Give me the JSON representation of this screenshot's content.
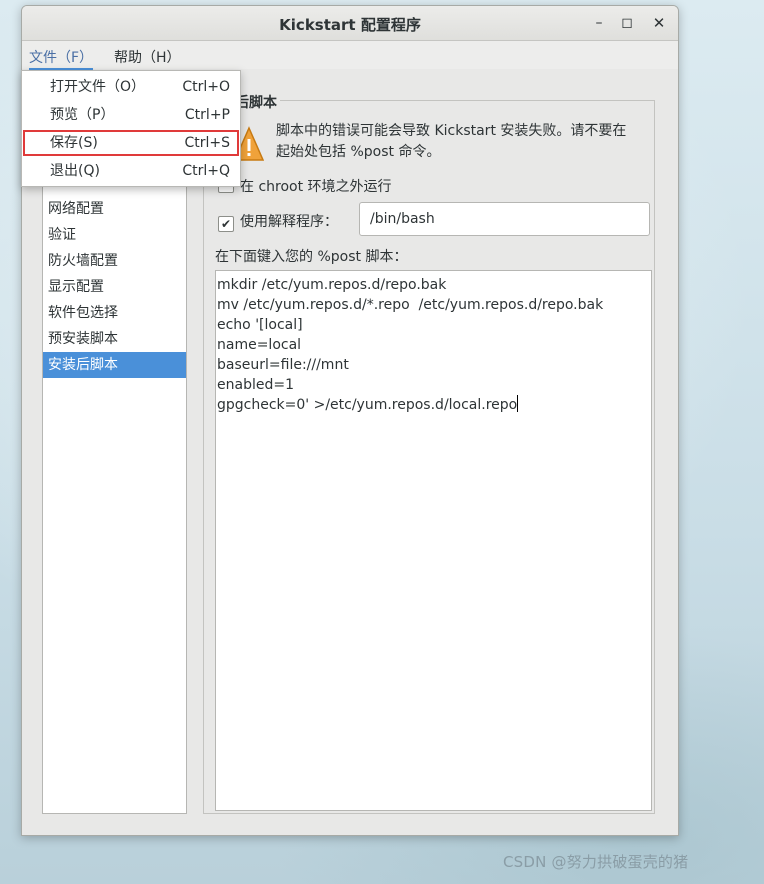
{
  "window": {
    "title": "Kickstart 配置程序",
    "controls": {
      "minimize": "–",
      "maximize": "◻",
      "close": "✕"
    }
  },
  "menubar": {
    "file": "文件（F）",
    "help": "帮助（H）"
  },
  "file_menu": {
    "items": [
      {
        "label": "打开文件（O）",
        "accel": "Ctrl+O"
      },
      {
        "label": "预览（P）",
        "accel": "Ctrl+P"
      },
      {
        "label": "保存(S)",
        "accel": "Ctrl+S"
      },
      {
        "label": "退出(Q)",
        "accel": "Ctrl+Q"
      }
    ],
    "highlighted_index": 2,
    "highlight_color": "#e03a3a"
  },
  "sidebar": {
    "items": [
      {
        "label": "网络配置",
        "selected": false
      },
      {
        "label": "验证",
        "selected": false
      },
      {
        "label": "防火墙配置",
        "selected": false
      },
      {
        "label": "显示配置",
        "selected": false
      },
      {
        "label": "软件包选择",
        "selected": false
      },
      {
        "label": "预安装脚本",
        "selected": false
      },
      {
        "label": "安装后脚本",
        "selected": true
      }
    ],
    "selected_color": "#4a90d9"
  },
  "panel": {
    "title": "后脚本",
    "warning_icon": "warning-triangle-icon",
    "warning_text": "脚本中的错误可能会导致 Kickstart 安装失败。请不要在起始处包括 %post 命令。",
    "chroot_label": "在 chroot 环境之外运行",
    "chroot_checked": false,
    "interpreter_label": "使用解释程序：",
    "interpreter_checked": true,
    "interpreter_value": "/bin/bash",
    "script_label": "在下面键入您的 %post 脚本：",
    "script_lines": [
      "mkdir /etc/yum.repos.d/repo.bak",
      "mv /etc/yum.repos.d/*.repo  /etc/yum.repos.d/repo.bak",
      "echo '[local]",
      "name=local",
      "baseurl=file:///mnt",
      "enabled=1",
      "gpgcheck=0' >/etc/yum.repos.d/local.repo"
    ]
  },
  "watermark": "CSDN @努力拱破蛋壳的猪"
}
